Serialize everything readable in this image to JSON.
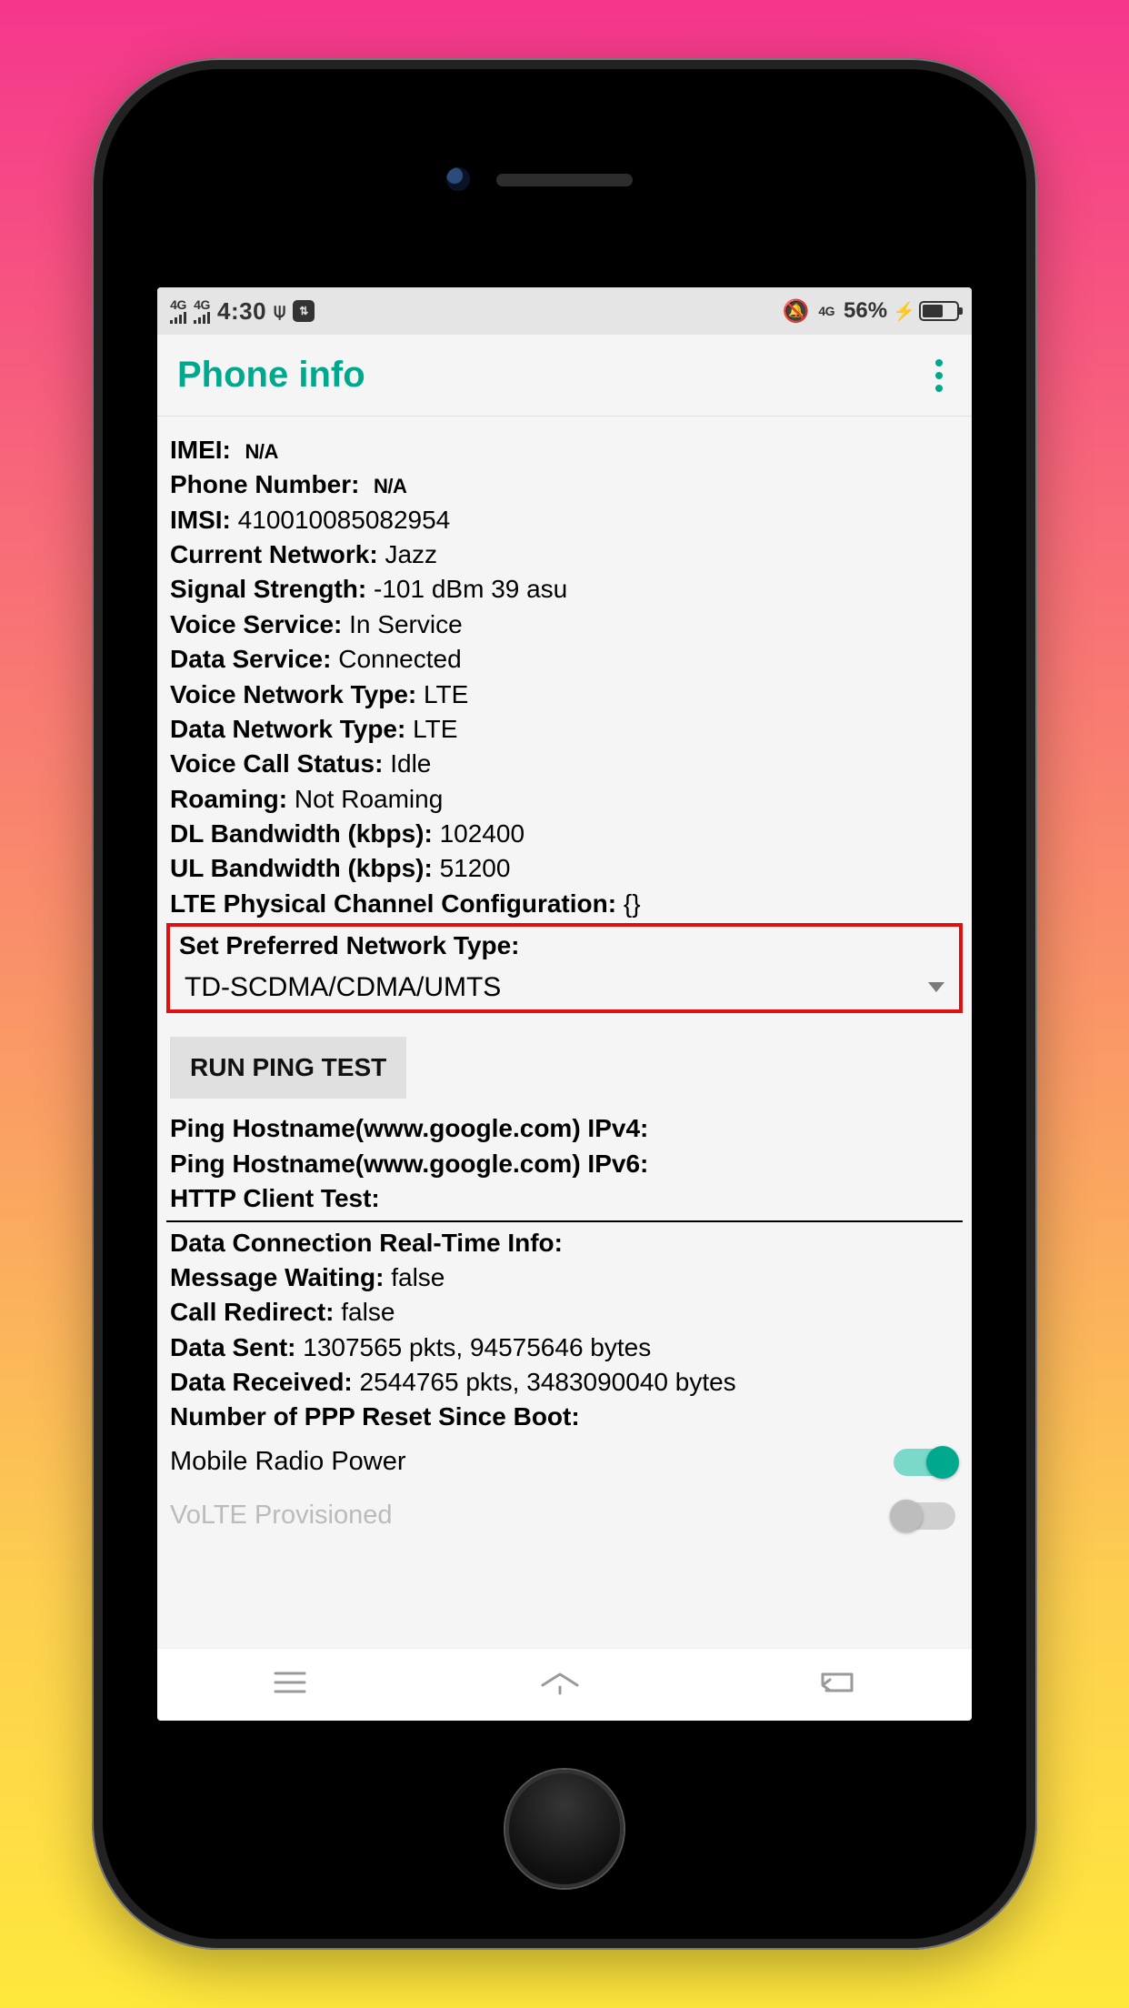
{
  "status_bar": {
    "net_gen": "4G",
    "time": "4:30",
    "battery_percent": "56%"
  },
  "app_bar": {
    "title": "Phone info"
  },
  "info": {
    "imei_label": "IMEI:",
    "imei_value": "N/A",
    "phone_number_label": "Phone Number:",
    "phone_number_value": "N/A",
    "imsi_label": "IMSI:",
    "imsi_value": "410010085082954",
    "current_network_label": "Current Network:",
    "current_network_value": "Jazz",
    "signal_strength_label": "Signal Strength:",
    "signal_strength_value": "-101 dBm   39 asu",
    "voice_service_label": "Voice Service:",
    "voice_service_value": "In Service",
    "data_service_label": "Data Service:",
    "data_service_value": "Connected",
    "voice_network_type_label": "Voice Network Type:",
    "voice_network_type_value": "LTE",
    "data_network_type_label": "Data Network Type:",
    "data_network_type_value": "LTE",
    "voice_call_status_label": "Voice Call Status:",
    "voice_call_status_value": "Idle",
    "roaming_label": "Roaming:",
    "roaming_value": "Not Roaming",
    "dl_bandwidth_label": "DL Bandwidth (kbps):",
    "dl_bandwidth_value": "102400",
    "ul_bandwidth_label": "UL Bandwidth (kbps):",
    "ul_bandwidth_value": "51200",
    "lte_pcc_label": "LTE Physical Channel Configuration:",
    "lte_pcc_value": "{}",
    "preferred_network_label": "Set Preferred Network Type:",
    "preferred_network_value": "TD-SCDMA/CDMA/UMTS",
    "run_ping_label": "RUN PING TEST",
    "ping_ipv4_label": "Ping Hostname(www.google.com) IPv4:",
    "ping_ipv6_label": "Ping Hostname(www.google.com) IPv6:",
    "http_client_label": "HTTP Client Test:",
    "data_conn_rt_label": "Data Connection Real-Time Info:",
    "message_waiting_label": "Message Waiting:",
    "message_waiting_value": "false",
    "call_redirect_label": "Call Redirect:",
    "call_redirect_value": "false",
    "data_sent_label": "Data Sent:",
    "data_sent_value": "1307565 pkts, 94575646 bytes",
    "data_received_label": "Data Received:",
    "data_received_value": "2544765 pkts, 3483090040 bytes",
    "ppp_reset_label": "Number of PPP Reset Since Boot:",
    "mobile_radio_power_label": "Mobile Radio Power",
    "volte_provisioned_label": "VoLTE Provisioned"
  }
}
